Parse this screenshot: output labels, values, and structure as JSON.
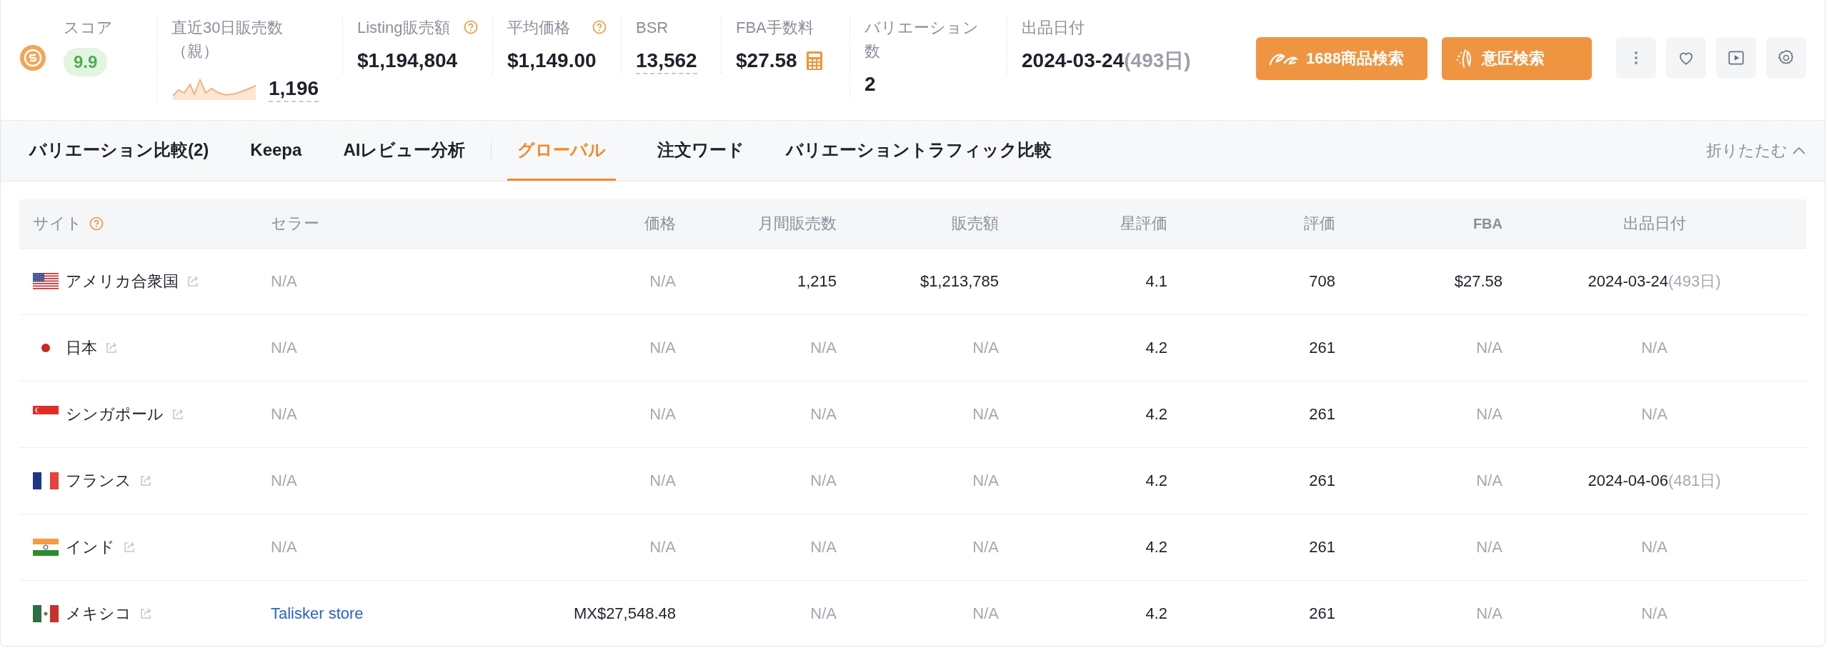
{
  "header": {
    "metrics": [
      {
        "kind": "score",
        "label": "スコア",
        "value": "9.9"
      },
      {
        "kind": "trend",
        "label": "直近30日販売数（親）",
        "value": "1,196",
        "dashed": true
      },
      {
        "kind": "plain",
        "label": "Listing販売額",
        "value": "$1,194,804",
        "help": true
      },
      {
        "kind": "plain",
        "label": "平均価格",
        "value": "$1,149.00",
        "help": true
      },
      {
        "kind": "plain",
        "label": "BSR",
        "value": "13,562",
        "dashed": true
      },
      {
        "kind": "plain",
        "label": "FBA手数料",
        "value": "$27.58",
        "calculator": true
      },
      {
        "kind": "plain",
        "label": "バリエーション数",
        "value": "2"
      },
      {
        "kind": "plain",
        "label": "出品日付",
        "value": "2024-03-24",
        "note": "(493日)"
      }
    ],
    "buttons": [
      {
        "label": "1688商品検索",
        "kind": "logo"
      },
      {
        "label": "意匠検索",
        "kind": "sparkle"
      }
    ],
    "icon_buttons": [
      {
        "kind": "more"
      },
      {
        "kind": "heart"
      },
      {
        "kind": "play"
      },
      {
        "kind": "settings"
      }
    ]
  },
  "tabs": [
    {
      "label": "バリエーション比較(2)",
      "selected": false
    },
    {
      "label": "Keepa",
      "selected": false
    },
    {
      "label": "AIレビュー分析",
      "selected": false
    },
    {
      "label": "グローバル",
      "selected": true
    },
    {
      "label": "注文ワード",
      "selected": false
    },
    {
      "label": "バリエーショントラフィック比較",
      "selected": false
    }
  ],
  "collapse": {
    "label": "折りたたむ"
  },
  "table": {
    "columns": [
      {
        "label": "サイト",
        "help": true
      },
      {
        "label": "セラー"
      },
      {
        "label": "価格"
      },
      {
        "label": "月間販売数"
      },
      {
        "label": "販売額"
      },
      {
        "label": "星評価"
      },
      {
        "label": "評価"
      },
      {
        "label": "FBA"
      },
      {
        "label": "出品日付"
      }
    ],
    "rows": [
      {
        "cells": [
          {
            "text": "アメリカ合衆国",
            "kind": "us"
          },
          {
            "text": "N/A",
            "dim": true
          },
          {
            "text": "N/A",
            "dim": true
          },
          {
            "text": "1,215"
          },
          {
            "text": "$1,213,785"
          },
          {
            "text": "4.1"
          },
          {
            "text": "708"
          },
          {
            "text": "$27.58"
          },
          {
            "text": "2024-03-24",
            "note": "(493日)"
          }
        ]
      },
      {
        "cells": [
          {
            "text": "日本",
            "kind": "jp"
          },
          {
            "text": "N/A",
            "dim": true
          },
          {
            "text": "N/A",
            "dim": true
          },
          {
            "text": "N/A",
            "dim": true
          },
          {
            "text": "N/A",
            "dim": true
          },
          {
            "text": "4.2"
          },
          {
            "text": "261"
          },
          {
            "text": "N/A",
            "dim": true
          },
          {
            "text": "N/A",
            "dim": true
          }
        ]
      },
      {
        "cells": [
          {
            "text": "シンガポール",
            "kind": "sg"
          },
          {
            "text": "N/A",
            "dim": true
          },
          {
            "text": "N/A",
            "dim": true
          },
          {
            "text": "N/A",
            "dim": true
          },
          {
            "text": "N/A",
            "dim": true
          },
          {
            "text": "4.2"
          },
          {
            "text": "261"
          },
          {
            "text": "N/A",
            "dim": true
          },
          {
            "text": "N/A",
            "dim": true
          }
        ]
      },
      {
        "cells": [
          {
            "text": "フランス",
            "kind": "fr"
          },
          {
            "text": "N/A",
            "dim": true
          },
          {
            "text": "N/A",
            "dim": true
          },
          {
            "text": "N/A",
            "dim": true
          },
          {
            "text": "N/A",
            "dim": true
          },
          {
            "text": "4.2"
          },
          {
            "text": "261"
          },
          {
            "text": "N/A",
            "dim": true
          },
          {
            "text": "2024-04-06",
            "note": "(481日)"
          }
        ]
      },
      {
        "cells": [
          {
            "text": "インド",
            "kind": "in"
          },
          {
            "text": "N/A",
            "dim": true
          },
          {
            "text": "N/A",
            "dim": true
          },
          {
            "text": "N/A",
            "dim": true
          },
          {
            "text": "N/A",
            "dim": true
          },
          {
            "text": "4.2"
          },
          {
            "text": "261"
          },
          {
            "text": "N/A",
            "dim": true
          },
          {
            "text": "N/A",
            "dim": true
          }
        ]
      },
      {
        "cells": [
          {
            "text": "メキシコ",
            "kind": "mx"
          },
          {
            "text": "Talisker store",
            "link": true
          },
          {
            "text": "MX$27,548.48"
          },
          {
            "text": "N/A",
            "dim": true
          },
          {
            "text": "N/A",
            "dim": true
          },
          {
            "text": "4.2"
          },
          {
            "text": "261"
          },
          {
            "text": "N/A",
            "dim": true
          },
          {
            "text": "N/A",
            "dim": true
          }
        ]
      }
    ]
  }
}
